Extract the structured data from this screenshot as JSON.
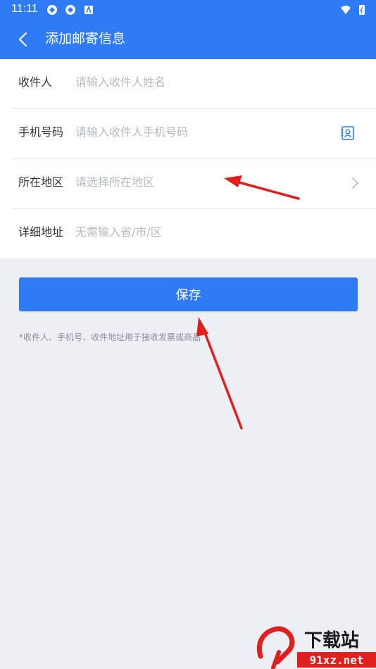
{
  "status_bar": {
    "time": "11:11"
  },
  "header": {
    "title": "添加邮寄信息"
  },
  "form": {
    "rows": [
      {
        "label": "收件人",
        "placeholder": "请输入收件人姓名"
      },
      {
        "label": "手机号码",
        "placeholder": "请输入收件人手机号码"
      },
      {
        "label": "所在地区",
        "placeholder": "请选择所在地区"
      },
      {
        "label": "详细地址",
        "placeholder": "无需输入省/市/区"
      }
    ]
  },
  "save_button": {
    "label": "保存"
  },
  "note": "*收件人、手机号、收件地址用于接收发票或商品",
  "watermark": {
    "text1": "下载站",
    "text2": "91xz.net"
  },
  "colors": {
    "accent": "#2F7BF5",
    "background": "#ECEFF4",
    "annotation": "#E0201E"
  }
}
